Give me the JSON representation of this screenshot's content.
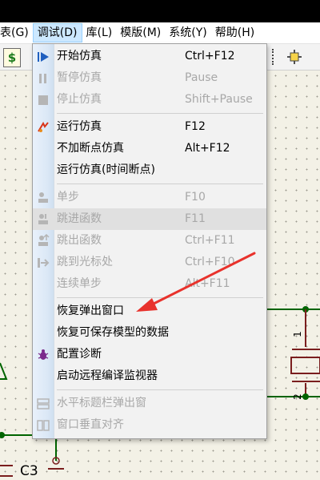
{
  "menubar": {
    "items": [
      "表(G)",
      "调试(D)",
      "库(L)",
      "模版(M)",
      "系统(Y)",
      "帮助(H)"
    ]
  },
  "toolbar": {
    "dollar_icon": "$"
  },
  "canvas": {
    "label_c3": "C3",
    "pin_1": "1",
    "pin_2": "2"
  },
  "debug_menu": {
    "items": [
      {
        "label": "开始仿真",
        "shortcut": "Ctrl+F12",
        "icon": "play-icon",
        "enabled": true
      },
      {
        "label": "暂停仿真",
        "shortcut": "Pause",
        "icon": "pause-icon",
        "enabled": false
      },
      {
        "label": "停止仿真",
        "shortcut": "Shift+Pause",
        "icon": "stop-icon",
        "enabled": false
      },
      {
        "label": "运行仿真",
        "shortcut": "F12",
        "icon": "run-icon",
        "enabled": true
      },
      {
        "label": "不加断点仿真",
        "shortcut": "Alt+F12",
        "icon": "",
        "enabled": true
      },
      {
        "label": "运行仿真(时间断点)",
        "shortcut": "",
        "icon": "",
        "enabled": true
      },
      {
        "label": "单步",
        "shortcut": "F10",
        "icon": "step-icon",
        "enabled": false
      },
      {
        "label": "跳进函数",
        "shortcut": "F11",
        "icon": "step-into-icon",
        "enabled": false
      },
      {
        "label": "跳出函数",
        "shortcut": "Ctrl+F11",
        "icon": "step-out-icon",
        "enabled": false
      },
      {
        "label": "跳到光标处",
        "shortcut": "Ctrl+F10",
        "icon": "run-to-cursor-icon",
        "enabled": false
      },
      {
        "label": "连续单步",
        "shortcut": "Alt+F11",
        "icon": "",
        "enabled": false
      },
      {
        "label": "恢复弹出窗口",
        "shortcut": "",
        "icon": "",
        "enabled": true
      },
      {
        "label": "恢复可保存模型的数据",
        "shortcut": "",
        "icon": "",
        "enabled": true
      },
      {
        "label": "配置诊断",
        "shortcut": "",
        "icon": "bug-icon",
        "enabled": true
      },
      {
        "label": "启动远程编译监视器",
        "shortcut": "",
        "icon": "",
        "enabled": true
      },
      {
        "label": "水平标题栏弹出窗",
        "shortcut": "",
        "icon": "horizontal-tile-icon",
        "enabled": false
      },
      {
        "label": "窗口垂直对齐",
        "shortcut": "",
        "icon": "vertical-tile-icon",
        "enabled": false
      }
    ]
  },
  "colors": {
    "menu_bg": "#f2f2f2",
    "disabled_text": "#a8a8a8",
    "wire_green": "#006400",
    "arrow_red": "#e8322c",
    "menubar_active": "#cce8ff"
  }
}
